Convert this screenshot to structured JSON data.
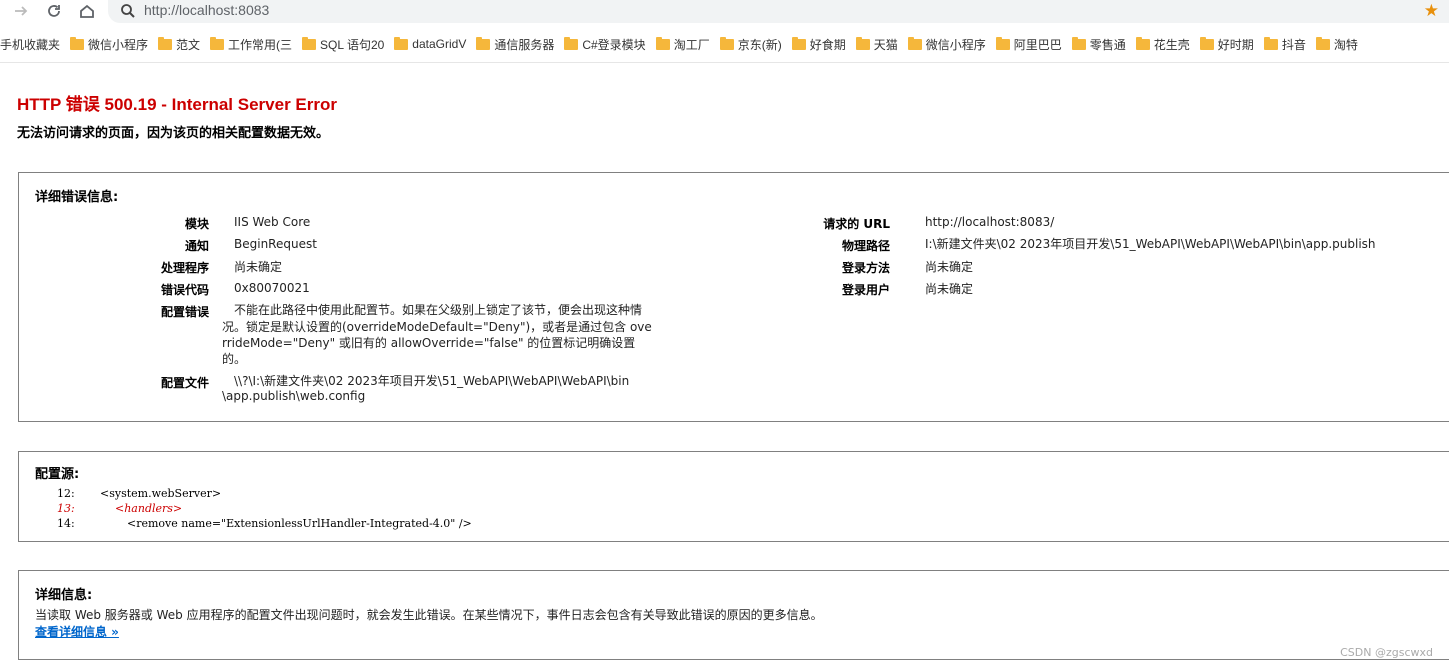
{
  "browser": {
    "url": "http://localhost:8083",
    "bookmarks": [
      "手机收藏夹",
      "微信小程序",
      "范文",
      "工作常用(三",
      "SQL 语句20",
      "dataGridV",
      "通信服务器",
      "C#登录模块",
      "淘工厂",
      "京东(新)",
      "好食期",
      "天猫",
      "微信小程序",
      "阿里巴巴",
      "零售通",
      "花生壳",
      "好时期",
      "抖音",
      "淘特"
    ]
  },
  "page": {
    "title": "HTTP 错误 500.19 - Internal Server Error",
    "subtitle": "无法访问请求的页面，因为该页的相关配置数据无效。",
    "detail_header": "详细错误信息:",
    "left": [
      {
        "label": "模块",
        "value": "IIS Web Core"
      },
      {
        "label": "通知",
        "value": "BeginRequest"
      },
      {
        "label": "处理程序",
        "value": "尚未确定"
      },
      {
        "label": "错误代码",
        "value": "0x80070021"
      }
    ],
    "config_error_label": "配置错误",
    "config_error_lines": [
      "不能在此路径中使用此配置节。如果在父级别上锁定了该节，便会出现这种情",
      "况。锁定是默认设置的(overrideModeDefault=\"Deny\")，或者是通过包含 ove",
      "rrideMode=\"Deny\" 或旧有的 allowOverride=\"false\" 的位置标记明确设置",
      "的。"
    ],
    "config_file_label": "配置文件",
    "config_file_lines": [
      "\\\\?\\I:\\新建文件夹\\02 2023年项目开发\\51_WebAPI\\WebAPI\\WebAPI\\bin",
      "\\app.publish\\web.config"
    ],
    "right": [
      {
        "label": "请求的 URL",
        "value": "http://localhost:8083/"
      },
      {
        "label": "物理路径",
        "value": "I:\\新建文件夹\\02 2023年项目开发\\51_WebAPI\\WebAPI\\WebAPI\\bin\\app.publish"
      },
      {
        "label": "登录方法",
        "value": "尚未确定"
      },
      {
        "label": "登录用户",
        "value": "尚未确定"
      }
    ],
    "source_header": "配置源:",
    "source_lines": [
      {
        "num": "12:",
        "code": "<system.webServer>"
      },
      {
        "num": "13:",
        "code": "<handlers>"
      },
      {
        "num": "14:",
        "code": "<remove name=\"ExtensionlessUrlHandler-Integrated-4.0\" />"
      }
    ],
    "more_header": "详细信息:",
    "more_text": "当读取 Web 服务器或 Web 应用程序的配置文件出现问题时，就会发生此错误。在某些情况下，事件日志会包含有关导致此错误的原因的更多信息。",
    "more_link": "查看详细信息 »",
    "watermark": "CSDN @zgscwxd"
  },
  "colors": {
    "title_red": "#cc0000",
    "link_blue": "#0066cc",
    "bookmark_folder": "#f5b73b",
    "star": "#e8900c"
  }
}
